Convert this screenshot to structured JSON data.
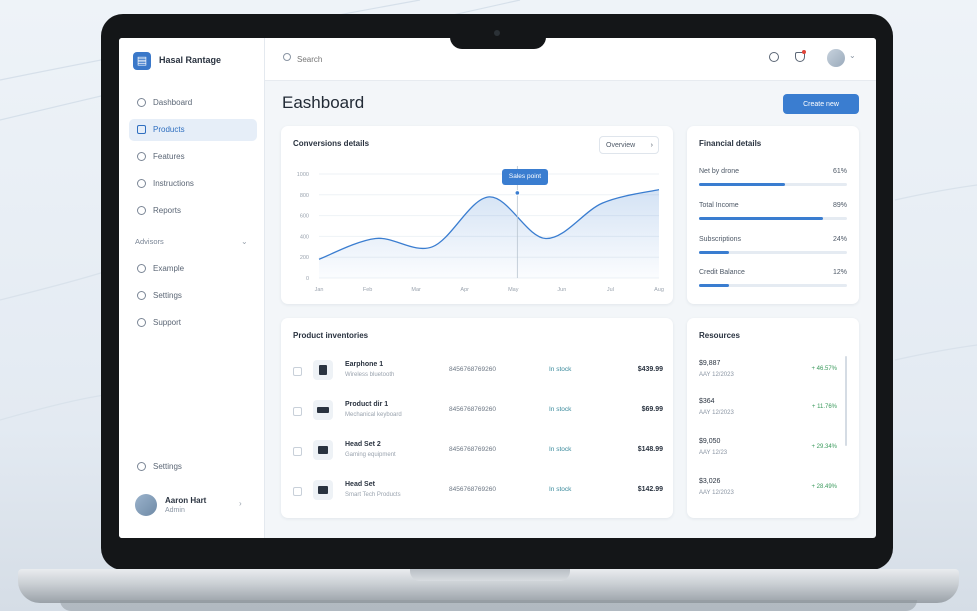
{
  "app": {
    "name": "Hasal Rantage"
  },
  "search": {
    "placeholder": "Search"
  },
  "sidebar": {
    "items": [
      {
        "label": "Dashboard"
      },
      {
        "label": "Products"
      },
      {
        "label": "Features"
      },
      {
        "label": "Instructions"
      },
      {
        "label": "Reports"
      }
    ],
    "section": {
      "label": "Advisors"
    },
    "sub_items": [
      {
        "label": "Example"
      },
      {
        "label": "Settings"
      },
      {
        "label": "Support"
      }
    ],
    "footer_item": {
      "label": "Settings"
    }
  },
  "user": {
    "name": "Aaron Hart",
    "role": "Admin"
  },
  "page": {
    "title": "Eashboard",
    "primary_button": "Create new"
  },
  "chart_card": {
    "title": "Conversions details",
    "dropdown": "Overview",
    "tooltip": "Sales point"
  },
  "chart_data": {
    "type": "area",
    "title": "Conversions details",
    "x": [
      "Jan",
      "Feb",
      "Mar",
      "Apr",
      "May",
      "Jun",
      "Jul",
      "Aug"
    ],
    "y_ticks": [
      "1000",
      "800",
      "600",
      "400",
      "200",
      "0"
    ],
    "ylim": [
      0,
      1000
    ],
    "series": [
      {
        "values": [
          180,
          380,
          300,
          780,
          380,
          720,
          850
        ]
      }
    ],
    "highlight_index": 4,
    "grid": true
  },
  "stats_card": {
    "title": "Financial details",
    "items": [
      {
        "label": "Net by drone",
        "value": "61%",
        "fill": 0.58
      },
      {
        "label": "Total Income",
        "value": "89%",
        "fill": 0.84
      },
      {
        "label": "Subscriptions",
        "value": "24%",
        "fill": 0.2
      },
      {
        "label": "Credit Balance",
        "value": "12%",
        "fill": 0.2
      }
    ]
  },
  "products_card": {
    "title": "Product inventories",
    "rows": [
      {
        "name": "Earphone 1",
        "sub": "Wireless bluetooth",
        "id": "8456768769260",
        "status": "In stock",
        "price": "$439.99"
      },
      {
        "name": "Product dir 1",
        "sub": "Mechanical keyboard",
        "id": "8456768769260",
        "status": "In stock",
        "price": "$69.99"
      },
      {
        "name": "Head Set 2",
        "sub": "Gaming equipment",
        "id": "8456768769260",
        "status": "In stock",
        "price": "$148.99"
      },
      {
        "name": "Head Set",
        "sub": "Smart Tech Products",
        "id": "8456768769260",
        "status": "In stock",
        "price": "$142.99"
      }
    ]
  },
  "resources_card": {
    "title": "Resources",
    "rows": [
      {
        "a": "$9,887",
        "b": "AAY 12/2023",
        "c": "+ 46.57%"
      },
      {
        "a": "$364",
        "b": "AAY 12/2023",
        "c": "+ 11.76%"
      },
      {
        "a": "$9,050",
        "b": "AAY 12/23",
        "c": "+ 29.34%"
      },
      {
        "a": "$3,026",
        "b": "AAY 12/2023",
        "c": "+ 28.49%"
      }
    ]
  },
  "colors": {
    "accent": "#3a7dd0",
    "status": "#3a8a9c",
    "positive": "#3a9a5c"
  }
}
